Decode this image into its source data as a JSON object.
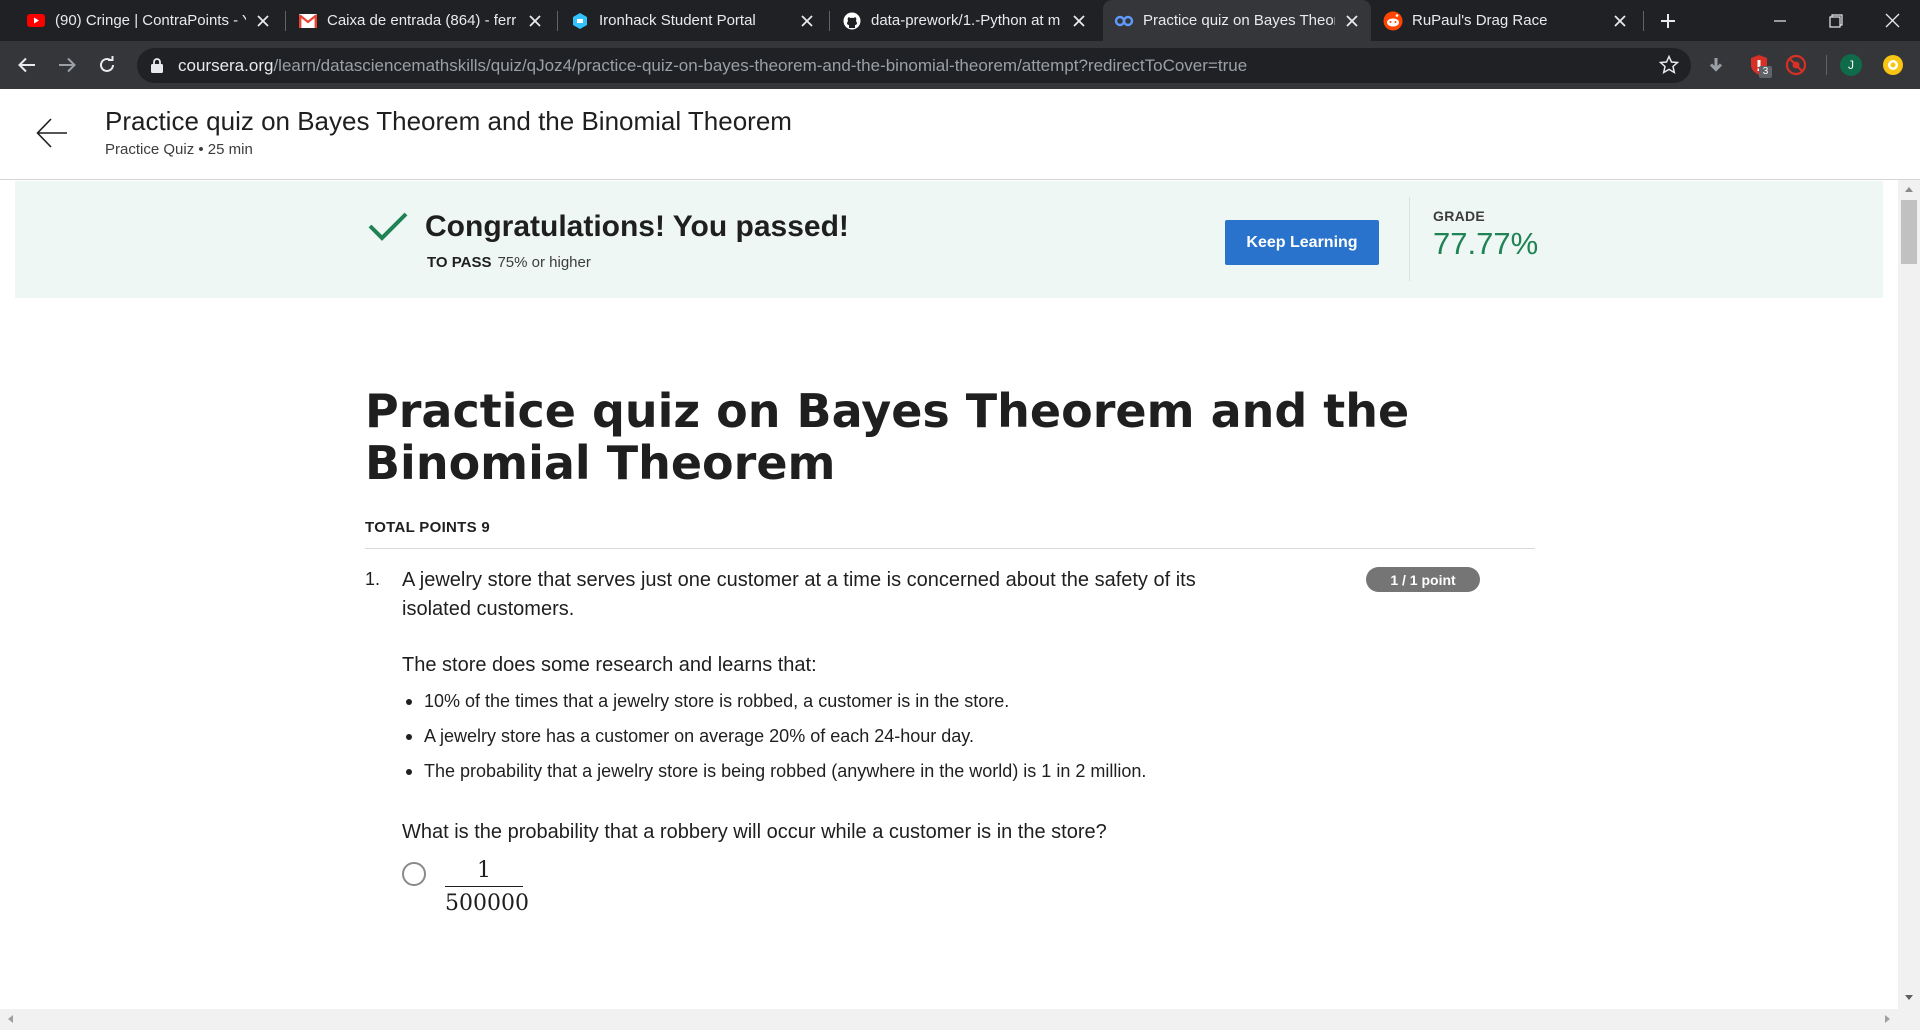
{
  "browser": {
    "tabs": [
      {
        "title": "(90) Cringe | ContraPoints - Y",
        "icon": "youtube-icon",
        "color": "#ff0000"
      },
      {
        "title": "Caixa de entrada (864) - ferr",
        "icon": "gmail-icon",
        "color": "#ea4335"
      },
      {
        "title": "Ironhack Student Portal",
        "icon": "ironhack-icon",
        "color": "#32c3ff"
      },
      {
        "title": "data-prework/1.-Python at m",
        "icon": "github-icon",
        "color": "#ffffff"
      },
      {
        "title": "Practice quiz on Bayes Theor",
        "icon": "coursera-icon",
        "color": "#2a73cc"
      },
      {
        "title": "RuPaul's Drag Race",
        "icon": "reddit-icon",
        "color": "#ff4500"
      }
    ],
    "active_tab_index": 4,
    "url": {
      "domain": "coursera.org",
      "path": "/learn/datasciencemathskills/quiz/qJoz4/practice-quiz-on-bayes-theorem-and-the-binomial-theorem/attempt?redirectToCover=true"
    },
    "extension_badge": "3",
    "profile_initial": "J"
  },
  "header": {
    "title": "Practice quiz on Bayes Theorem and the Binomial Theorem",
    "subtitle": "Practice Quiz • 25 min"
  },
  "banner": {
    "message": "Congratulations! You passed!",
    "to_pass_label": "TO PASS",
    "to_pass_value": "75% or higher",
    "button_label": "Keep Learning",
    "grade_label": "GRADE",
    "grade_value": "77.77%",
    "grade_color": "#1f8354",
    "accent": "#2a73cc"
  },
  "quiz": {
    "title": "Practice quiz on Bayes Theorem and the Binomial Theorem",
    "total_points": "TOTAL POINTS 9",
    "questions": [
      {
        "number": "1.",
        "text": "A jewelry store that serves just one customer at a time is concerned about the safety of its isolated customers.",
        "points": "1 / 1 point",
        "paragraph": "The store does some research and learns that:",
        "bullets": [
          "10% of the times that a jewelry store is robbed, a customer is in the store.",
          "A jewelry store has a customer on average 20% of each 24-hour day.",
          "The probability that a jewelry store is being robbed (anywhere in the world) is 1 in 2 million."
        ],
        "ask": "What is the probability that a robbery will occur while a customer is in the store?",
        "options": [
          {
            "numerator": "1",
            "denominator": "500000"
          }
        ]
      }
    ]
  }
}
